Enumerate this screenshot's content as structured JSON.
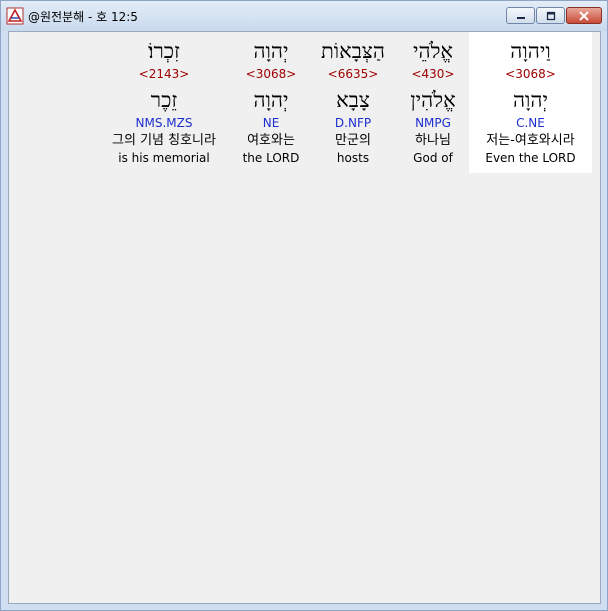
{
  "window": {
    "title": "@원전분해 - 호 12:5",
    "controls": {
      "minimize": "minimize-icon",
      "maximize": "maximize-icon",
      "close": "close-icon"
    }
  },
  "words": [
    {
      "hebrew": "וַיהוָה",
      "strong": "<3068>",
      "lemma": "יְהוָה",
      "morph": "C.NE",
      "korean": "저는-여호와시라",
      "english": "Even the LORD",
      "highlighted": true
    },
    {
      "hebrew": "אֱלֹהֵי",
      "strong": "<430>",
      "lemma": "אֱלֹהִין",
      "morph": "NMPG",
      "korean": "하나님",
      "english": "God of",
      "highlighted": false
    },
    {
      "hebrew": "הַצְּבָאוֹת",
      "strong": "<6635>",
      "lemma": "צָבָא",
      "morph": "D.NFP",
      "korean": "만군의",
      "english": "hosts",
      "highlighted": false
    },
    {
      "hebrew": "יְהוָה",
      "strong": "<3068>",
      "lemma": "יְהוָה",
      "morph": "NE",
      "korean": "여호와는",
      "english": "the LORD",
      "highlighted": false
    },
    {
      "hebrew": "זִכְרוֹ׃",
      "strong": "<2143>",
      "lemma": "זֵכֶר",
      "morph": "NMS.MZS",
      "korean": "그의 기념 칭호니라",
      "english": "is his memorial",
      "highlighted": false
    }
  ],
  "colors": {
    "strong": "#a00000",
    "morph": "#1d2ecf",
    "highlight": "#ffffff",
    "background": "#f0f0f0"
  }
}
